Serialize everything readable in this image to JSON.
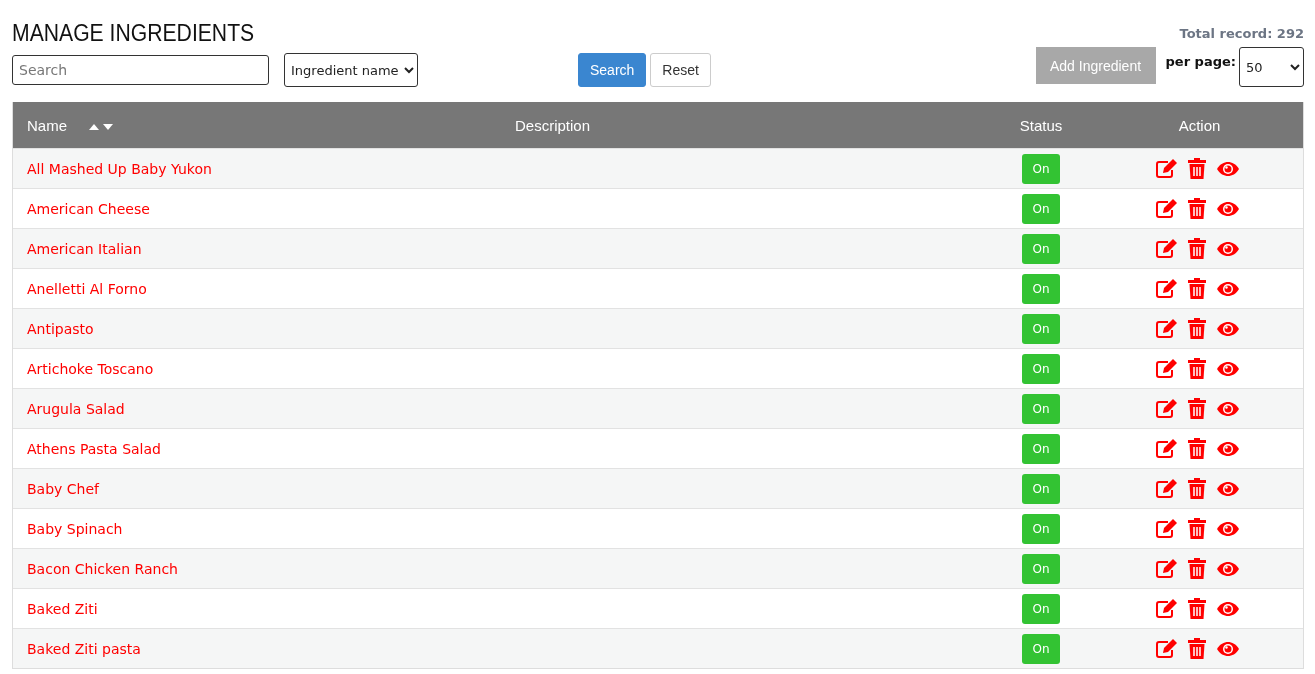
{
  "title": "MANAGE INGREDIENTS",
  "search": {
    "placeholder": "Search"
  },
  "filter": {
    "value": "Ingredient name"
  },
  "buttons": [
    {
      "label": "Search",
      "kind": "primary"
    },
    {
      "label": "Reset",
      "kind": "default"
    }
  ],
  "total_record": "Total record: 292",
  "add_button": "Add Ingredient",
  "per_page": {
    "label": "per page:",
    "value": "50"
  },
  "table": {
    "columns": [
      "Name",
      "Description",
      "Status",
      "Action"
    ],
    "rows": [
      {
        "name": "All Mashed Up Baby Yukon",
        "status": "On",
        "on": true
      },
      {
        "name": "American Cheese",
        "status": "On",
        "on": true
      },
      {
        "name": "American Italian",
        "status": "On",
        "on": true
      },
      {
        "name": "Anelletti Al Forno",
        "status": "On",
        "on": true
      },
      {
        "name": "Antipasto",
        "status": "On",
        "on": true
      },
      {
        "name": "Artichoke Toscano",
        "status": "On",
        "on": true
      },
      {
        "name": "Arugula Salad",
        "status": "On",
        "on": true
      },
      {
        "name": "Athens Pasta Salad",
        "status": "On",
        "on": true
      },
      {
        "name": "Baby Chef",
        "status": "On",
        "on": true
      },
      {
        "name": "Baby Spinach",
        "status": "On",
        "on": true
      },
      {
        "name": "Bacon Chicken Ranch",
        "status": "On",
        "on": true
      },
      {
        "name": "Baked Ziti",
        "status": "On",
        "on": true
      },
      {
        "name": "Baked Ziti pasta",
        "status": "On",
        "on": true
      }
    ]
  }
}
